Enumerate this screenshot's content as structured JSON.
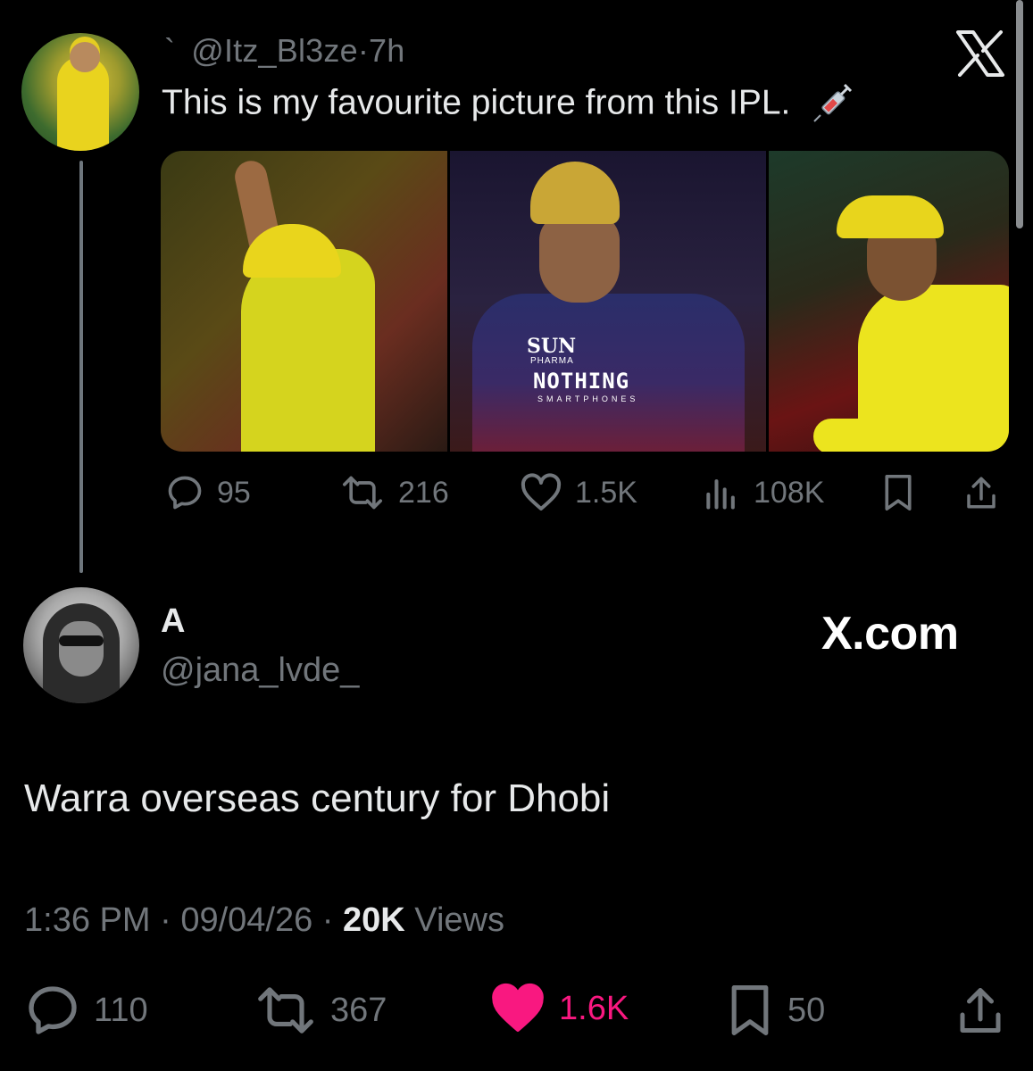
{
  "quoted_tweet": {
    "header_prefix": "`",
    "handle": "@Itz_Bl3ze",
    "separator": "·",
    "time": "7h",
    "text": "This is my favourite picture from this IPL.",
    "actions": {
      "replies": "95",
      "retweets": "216",
      "likes": "1.5K",
      "views": "108K"
    }
  },
  "reply_tweet": {
    "name": "A",
    "handle": "@jana_lvde_",
    "text": "Warra overseas century for Dhobi",
    "time": "1:36 PM",
    "date": "09/04/26",
    "views_count": "20K",
    "views_label": "Views",
    "separator": "·",
    "actions": {
      "replies": "110",
      "retweets": "367",
      "likes": "1.6K",
      "bookmarks": "50"
    }
  },
  "watermark": "X.com",
  "media_text": {
    "sun": "SUN",
    "pharma": "PHARMA",
    "nothing": "NOTHING",
    "smartphones": "SMARTPHONES"
  },
  "colors": {
    "background": "#000000",
    "text_primary": "#e7e9ea",
    "text_secondary": "#71767b",
    "like_active": "#f91880"
  },
  "icons": [
    "x-logo-icon",
    "syringe-icon",
    "reply-icon",
    "retweet-icon",
    "like-icon",
    "views-icon",
    "bookmark-icon",
    "share-icon"
  ]
}
